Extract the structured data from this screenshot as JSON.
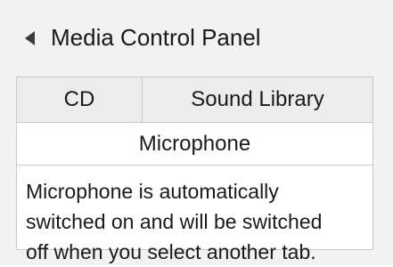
{
  "panel": {
    "title": "Media Control Panel",
    "collapse_icon": "caret-left-icon"
  },
  "tabs": [
    {
      "label": "CD"
    },
    {
      "label": "Sound Library"
    }
  ],
  "active_tab": {
    "label": "Microphone"
  },
  "description": "Microphone is automatically\nswitched on and will be switched\noff when you select another tab."
}
